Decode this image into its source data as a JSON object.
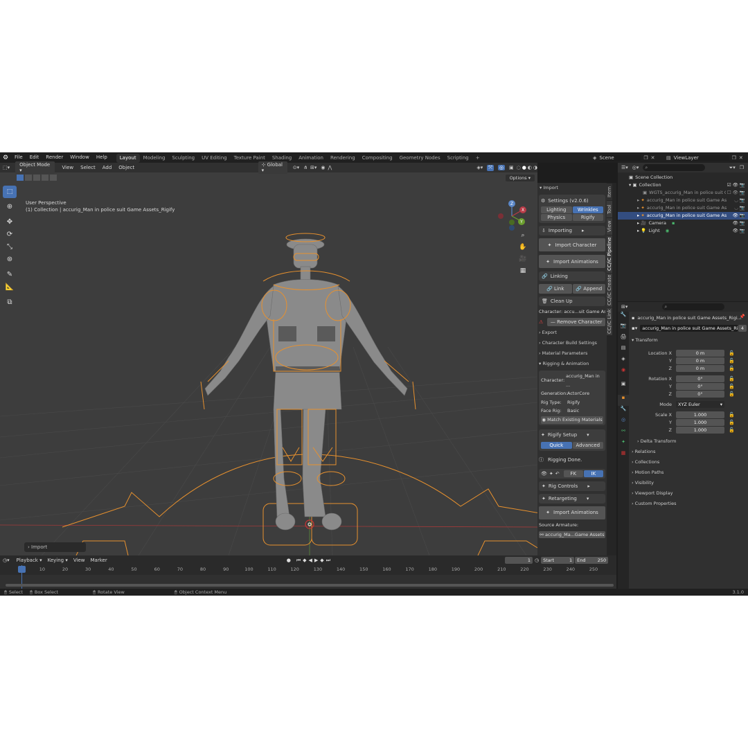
{
  "topbar": {
    "menus": [
      "File",
      "Edit",
      "Render",
      "Window",
      "Help"
    ],
    "workspaces": [
      "Layout",
      "Modeling",
      "Sculpting",
      "UV Editing",
      "Texture Paint",
      "Shading",
      "Animation",
      "Rendering",
      "Compositing",
      "Geometry Nodes",
      "Scripting"
    ],
    "active_workspace": "Layout",
    "add_tab": "+",
    "scene": "Scene",
    "view_layer": "ViewLayer"
  },
  "viewport": {
    "mode": "Object Mode",
    "menus": [
      "View",
      "Select",
      "Add",
      "Object"
    ],
    "transform_orientation": "Global",
    "options": "Options",
    "view_name": "User Perspective",
    "object_info": "(1) Collection | accurig_Man in police suit Game Assets_Rigify",
    "gizmo": {
      "x": "X",
      "y": "Y",
      "z": "Z"
    },
    "last_op": "Import"
  },
  "npanel": {
    "tabs": [
      "Item",
      "Tool",
      "View",
      "CC/iC Pipeline",
      "CC/iC Create",
      "CC/iC Link"
    ],
    "header": "Import",
    "settings": "Settings  (v2.0.6)",
    "lighting": "Lighting",
    "wrinkles": "Wrinkles",
    "physics": "Physics",
    "rigify": "Rigify",
    "importing": "Importing",
    "import_character": "Import Character",
    "import_animations": "Import Animations",
    "linking": "Linking",
    "link": "Link",
    "append": "Append",
    "clean_up": "Clean Up",
    "character_label": "Character: accu...uit Game Asset",
    "remove_character": "Remove Character",
    "export": "Export",
    "character_build": "Character Build Settings",
    "material_params": "Material Parameters",
    "rigging_animation": "Rigging & Animation",
    "info": [
      {
        "k": "Character:",
        "v": "accurig_Man in ..."
      },
      {
        "k": "Generation:",
        "v": "ActorCore"
      },
      {
        "k": "Rig Type:",
        "v": "Rigify"
      },
      {
        "k": "Face Rig:",
        "v": "Basic"
      }
    ],
    "match_materials": "Match Existing Materials",
    "rigify_setup": "Rigify Setup",
    "quick": "Quick",
    "advanced": "Advanced",
    "rigging_done": "Rigging Done.",
    "fk": "FK",
    "ik": "IK",
    "rig_controls": "Rig Controls",
    "retargeting": "Retargeting",
    "import_animations2": "Import Animations",
    "source_armature": "Source Armature:",
    "source_value": "accurig_Ma...Game Assets"
  },
  "timeline": {
    "menus": [
      "Playback",
      "Keying",
      "View",
      "Marker"
    ],
    "current_frame": "1",
    "start_label": "Start",
    "start": "1",
    "end_label": "End",
    "end": "250",
    "ticks": [
      "1",
      "10",
      "20",
      "30",
      "40",
      "50",
      "60",
      "70",
      "80",
      "90",
      "100",
      "110",
      "120",
      "130",
      "140",
      "150",
      "160",
      "170",
      "180",
      "190",
      "200",
      "210",
      "220",
      "230",
      "240",
      "250"
    ]
  },
  "statusbar": {
    "select": "Select",
    "box_select": "Box Select",
    "rotate_view": "Rotate View",
    "context_menu": "Object Context Menu",
    "version": "3.1.0"
  },
  "outliner": {
    "root": "Scene Collection",
    "items": [
      {
        "label": "Collection",
        "indent": 1
      },
      {
        "label": "WGTS_accurig_Man in police suit Ga",
        "indent": 2
      },
      {
        "label": "accurig_Man in police suit Game As",
        "indent": 2
      },
      {
        "label": "accurig_Man in police suit Game As",
        "indent": 2
      },
      {
        "label": "accurig_Man in police suit Game As",
        "indent": 2,
        "selected": true
      },
      {
        "label": "Camera",
        "indent": 2
      },
      {
        "label": "Light",
        "indent": 2
      }
    ]
  },
  "properties": {
    "object_path": "accurig_Man in police suit Game Assets_Rigi...",
    "object_name": "accurig_Man in police suit Game Assets_Ri...",
    "users": "4",
    "transform": "Transform",
    "location_label": "Location X",
    "location": [
      "0 m",
      "0 m",
      "0 m"
    ],
    "rotation_label": "Rotation X",
    "rotation": [
      "0°",
      "0°",
      "0°"
    ],
    "mode_label": "Mode",
    "mode": "XYZ Euler",
    "scale_label": "Scale X",
    "scale": [
      "1.000",
      "1.000",
      "1.000"
    ],
    "y": "Y",
    "z": "Z",
    "delta": "Delta Transform",
    "sections": [
      "Relations",
      "Collections",
      "Motion Paths",
      "Visibility",
      "Viewport Display",
      "Custom Properties"
    ]
  },
  "colors": {
    "accent": "#4772b3",
    "selection": "#f0992d",
    "bg": "#1d1d1d"
  }
}
